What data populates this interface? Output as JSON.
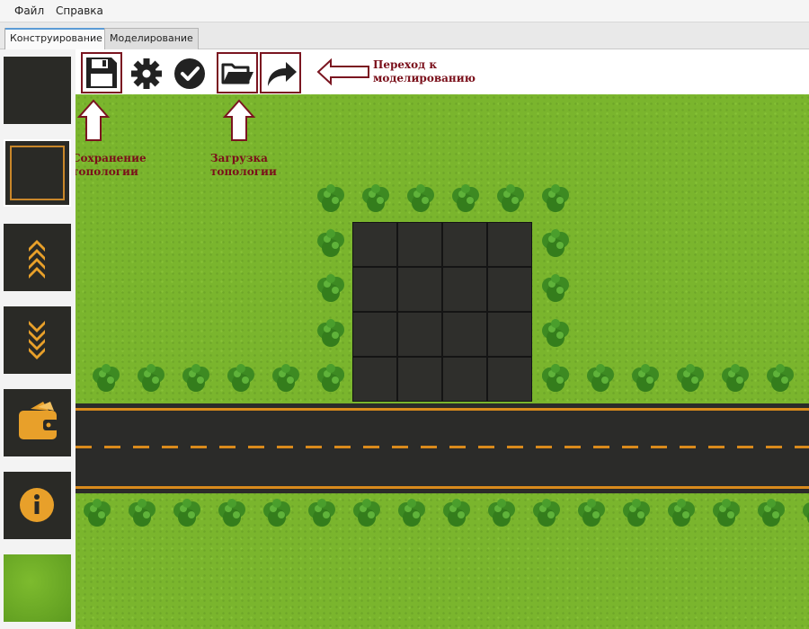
{
  "menu": {
    "items": [
      "Файл",
      "Справка"
    ]
  },
  "tabs": [
    {
      "label": "Конструирование",
      "active": true
    },
    {
      "label": "Моделирование",
      "active": false
    }
  ],
  "palette": {
    "tiles": [
      "empty-dark-tile",
      "plot-outline-tile",
      "road-up-tile",
      "road-down-tile",
      "wallet-tile",
      "info-tile",
      "grass-tile"
    ],
    "selected": "plot-outline-tile"
  },
  "toolbar": {
    "tools": [
      "save-icon",
      "settings-gear-icon",
      "check-circle-icon",
      "folder-open-icon",
      "redo-arrow-icon"
    ]
  },
  "annotations": {
    "save": "Сохранение\nтопологии",
    "load": "Загрузка\nтопологии",
    "modeling": "Переход к\nмоделированию"
  },
  "colors": {
    "grass": "#7ab52d",
    "asphalt": "#2b2b29",
    "road_line": "#d98a1c",
    "annotation": "#7a0f1a",
    "tab_accent": "#5b9bd5"
  },
  "scene": {
    "building": {
      "rows": 4,
      "cols": 4
    },
    "road": "horizontal-two-lane",
    "bush_rows": 3
  }
}
